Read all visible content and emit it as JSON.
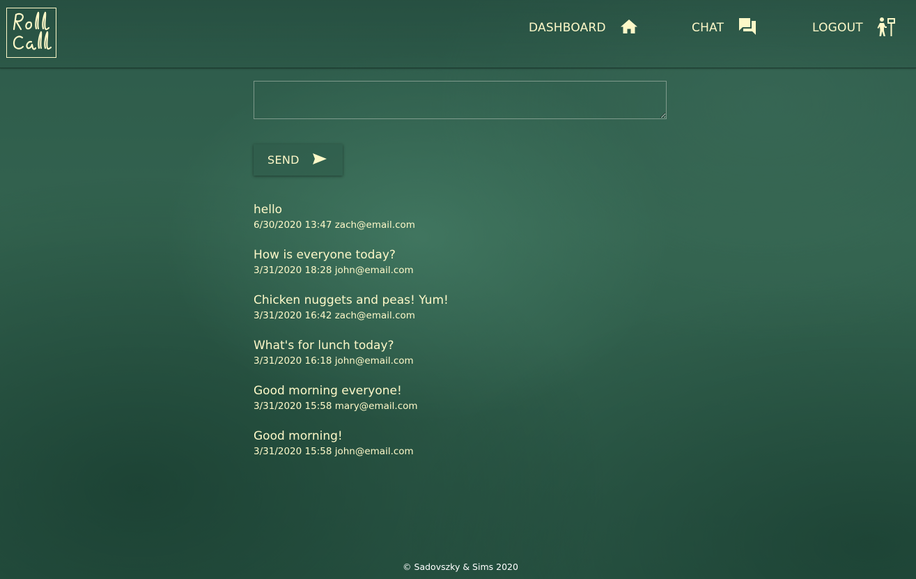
{
  "header": {
    "logo_text": "Roll Call",
    "nav": {
      "dashboard": {
        "label": "DASHBOARD",
        "icon": "home-icon"
      },
      "chat": {
        "label": "CHAT",
        "icon": "chat-bubbles-icon"
      },
      "logout": {
        "label": "LOGOUT",
        "icon": "person-exit-sign-icon"
      }
    }
  },
  "composer": {
    "value": "",
    "placeholder": "",
    "send_label": "SEND",
    "send_icon": "send-arrow-icon"
  },
  "messages": [
    {
      "text": "hello",
      "timestamp": "6/30/2020 13:47",
      "author": "zach@email.com"
    },
    {
      "text": "How is everyone today?",
      "timestamp": "3/31/2020 18:28",
      "author": "john@email.com"
    },
    {
      "text": "Chicken nuggets and peas! Yum!",
      "timestamp": "3/31/2020 16:42",
      "author": "zach@email.com"
    },
    {
      "text": "What's for lunch today?",
      "timestamp": "3/31/2020 16:18",
      "author": "john@email.com"
    },
    {
      "text": "Good morning everyone!",
      "timestamp": "3/31/2020 15:58",
      "author": "mary@email.com"
    },
    {
      "text": "Good morning!",
      "timestamp": "3/31/2020 15:58",
      "author": "john@email.com"
    }
  ],
  "footer": {
    "text": "© Sadovszky & Sims 2020"
  },
  "colors": {
    "accent_text": "#fdf8c8",
    "background": "#2f5e4e"
  }
}
